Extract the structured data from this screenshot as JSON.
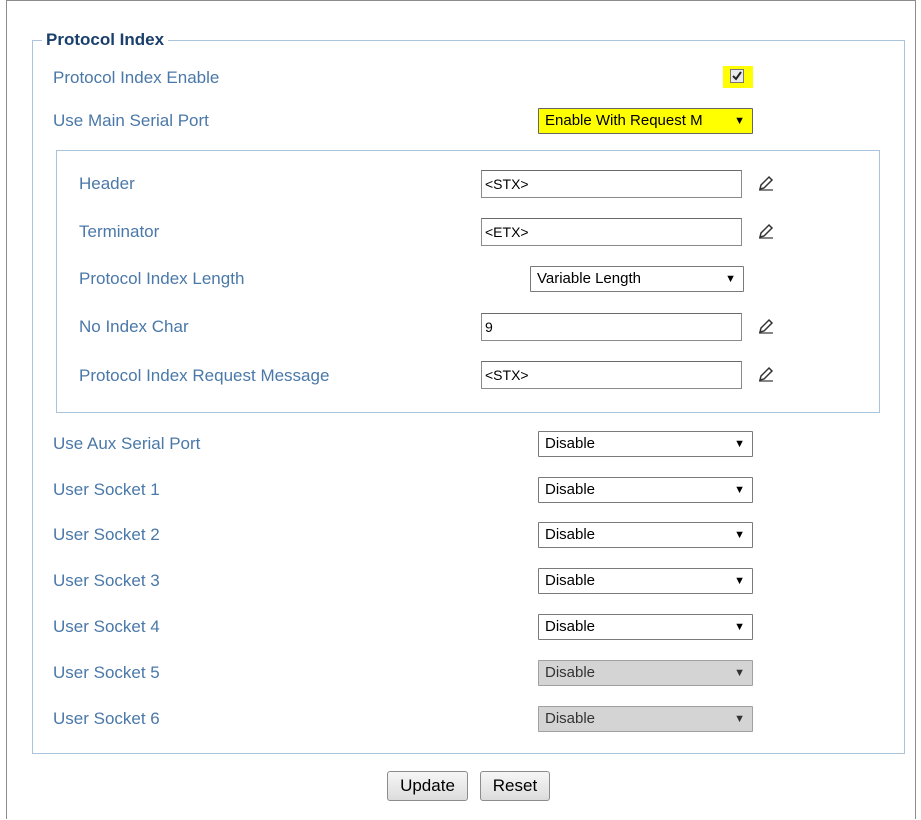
{
  "fieldset": {
    "legend": "Protocol Index"
  },
  "protocol_index_enable": {
    "label": "Protocol Index Enable",
    "checked": true
  },
  "use_main_serial_port": {
    "label": "Use Main Serial Port",
    "value": "Enable With Request M"
  },
  "inner": {
    "header": {
      "label": "Header",
      "value": "<STX>"
    },
    "terminator": {
      "label": "Terminator",
      "value": "<ETX>"
    },
    "length": {
      "label": "Protocol Index Length",
      "value": "Variable Length"
    },
    "no_index_char": {
      "label": "No Index Char",
      "value": "9"
    },
    "request_message": {
      "label": "Protocol Index Request Message",
      "value": "<STX>"
    }
  },
  "ports": [
    {
      "label": "Use Aux Serial Port",
      "value": "Disable",
      "disabled": false
    },
    {
      "label": "User Socket 1",
      "value": "Disable",
      "disabled": false
    },
    {
      "label": "User Socket 2",
      "value": "Disable",
      "disabled": false
    },
    {
      "label": "User Socket 3",
      "value": "Disable",
      "disabled": false
    },
    {
      "label": "User Socket 4",
      "value": "Disable",
      "disabled": false
    },
    {
      "label": "User Socket 5",
      "value": "Disable",
      "disabled": true
    },
    {
      "label": "User Socket 6",
      "value": "Disable",
      "disabled": true
    }
  ],
  "buttons": {
    "update": "Update",
    "reset": "Reset"
  },
  "icons": {
    "edit": "pencil-icon",
    "dropdown": "dropdown-arrow-icon",
    "checkbox": "checkmark-icon"
  },
  "colors": {
    "label": "#4a78a8",
    "legend": "#1a3f6b",
    "highlight": "#ffff00",
    "border": "#a9c4dc"
  }
}
